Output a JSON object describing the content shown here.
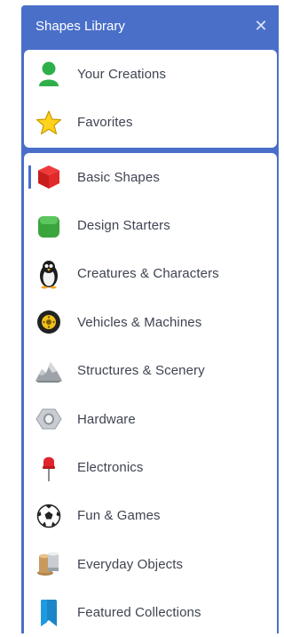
{
  "panel": {
    "title": "Shapes Library",
    "close_glyph": "✕",
    "accent_color": "#4a6fc9"
  },
  "top_section": [
    {
      "label": "Your Creations",
      "icon": "person-icon"
    },
    {
      "label": "Favorites",
      "icon": "star-icon"
    }
  ],
  "categories": [
    {
      "label": "Basic Shapes",
      "icon": "red-cube-icon",
      "selected": true
    },
    {
      "label": "Design Starters",
      "icon": "green-cube-icon"
    },
    {
      "label": "Creatures & Characters",
      "icon": "penguin-icon"
    },
    {
      "label": "Vehicles & Machines",
      "icon": "wheel-icon"
    },
    {
      "label": "Structures & Scenery",
      "icon": "rocks-icon"
    },
    {
      "label": "Hardware",
      "icon": "nut-icon"
    },
    {
      "label": "Electronics",
      "icon": "pin-icon"
    },
    {
      "label": "Fun & Games",
      "icon": "soccer-ball-icon"
    },
    {
      "label": "Everyday Objects",
      "icon": "cup-icon"
    },
    {
      "label": "Featured Collections",
      "icon": "bookmark-icon"
    }
  ]
}
